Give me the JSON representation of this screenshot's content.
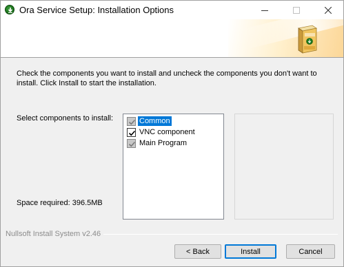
{
  "window": {
    "title": "Ora Service Setup: Installation Options",
    "icons": {
      "app": "installer-download-icon",
      "minimize": "minimize-icon",
      "maximize": "maximize-icon",
      "close": "close-icon"
    }
  },
  "header": {
    "icon": "software-box-icon"
  },
  "main": {
    "description": "Check the components you want to install and uncheck the components you don't want to install. Click Install to start the installation.",
    "select_label": "Select components to install:",
    "space_required": "Space required: 396.5MB",
    "components": [
      {
        "label": "Common",
        "checked": true,
        "grayed": true,
        "selected": true
      },
      {
        "label": "VNC component",
        "checked": true,
        "grayed": false,
        "selected": false
      },
      {
        "label": "Main Program",
        "checked": true,
        "grayed": true,
        "selected": false
      }
    ]
  },
  "footer": {
    "branding": "Nullsoft Install System v2.46",
    "back_label": "< Back",
    "install_label": "Install",
    "cancel_label": "Cancel"
  },
  "colors": {
    "selection": "#0078d7",
    "banner_accent": "#fcd696",
    "default_button_border": "#0078d7"
  }
}
